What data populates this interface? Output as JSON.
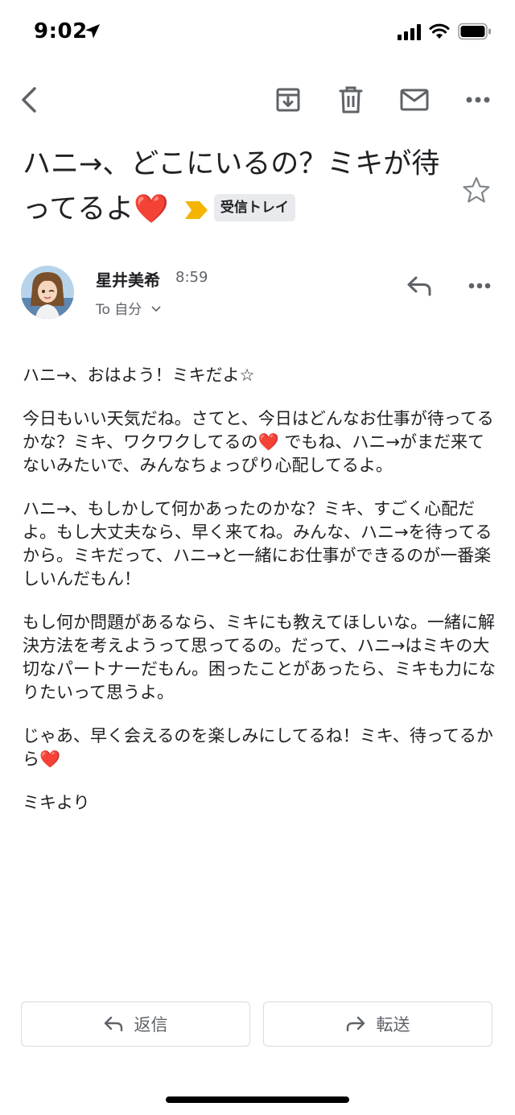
{
  "status_bar": {
    "time": "9:02"
  },
  "toolbar": {
    "back": "back-arrow",
    "archive": "archive",
    "delete": "trash",
    "mark_unread": "mail",
    "more": "more-horizontal"
  },
  "email": {
    "subject": "ハニ→、どこにいるの？ミキが待ってるよ❤️",
    "label": "受信トレイ",
    "sender_name": "星井美希",
    "time": "8:59",
    "recipient": "To 自分",
    "paragraphs": [
      "ハニ→、おはよう！ミキだよ☆",
      "今日もいい天気だね。さてと、今日はどんなお仕事が待ってるかな？ミキ、ワクワクしてるの❤️ でもね、ハニ→がまだ来てないみたいで、みんなちょっぴり心配してるよ。",
      "ハニ→、もしかして何かあったのかな？ミキ、すごく心配だよ。もし大丈夫なら、早く来てね。みんな、ハニ→を待ってるから。ミキだって、ハニ→と一緒にお仕事ができるのが一番楽しいんだもん！",
      "もし何か問題があるなら、ミキにも教えてほしいな。一緒に解決方法を考えようって思ってるの。だって、ハニ→はミキの大切なパートナーだもん。困ったことがあったら、ミキも力になりたいって思うよ。",
      "じゃあ、早く会えるのを楽しみにしてるね！ミキ、待ってるから❤️",
      "ミキより"
    ]
  },
  "actions": {
    "reply": "返信",
    "forward": "転送"
  },
  "colors": {
    "importance_marker": "#f4b400",
    "heart": "#e0245e"
  }
}
